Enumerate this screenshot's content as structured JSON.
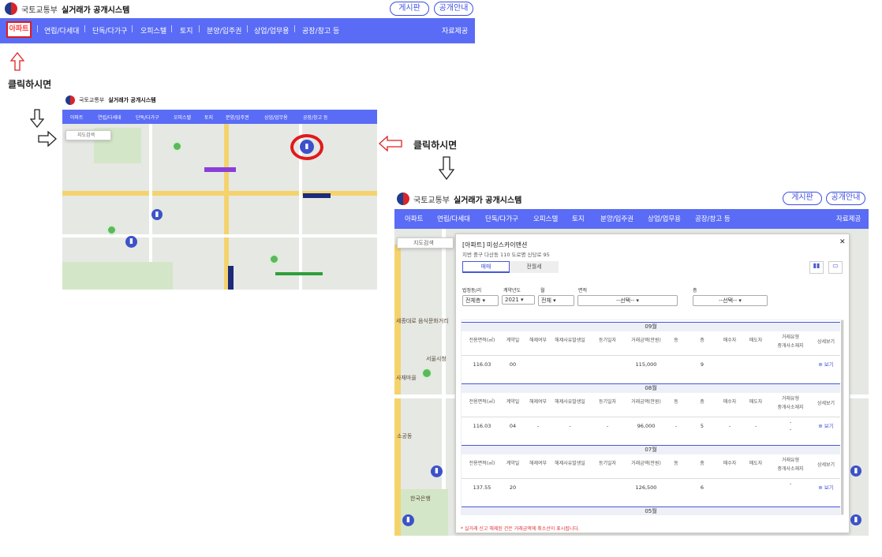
{
  "brand": {
    "org": "국토교통부",
    "system": "실거래가 공개시스템"
  },
  "top_buttons": {
    "board": "게시판",
    "info": "공개안내"
  },
  "nav": {
    "items": [
      "아파트",
      "연립/다세대",
      "단독/다가구",
      "오피스텔",
      "토지",
      "분양/입주권",
      "상업/업무용",
      "공장/창고 등"
    ],
    "right": "자료제공"
  },
  "annotations": {
    "click1": "클릭하시면",
    "click2": "클릭하시면"
  },
  "map_small": {
    "search_placeholder": "지도검색"
  },
  "map_large": {
    "search_placeholder": "지도검색",
    "labels": [
      "세종대로 음식문화거리",
      "서울시청",
      "사재마을",
      "한국은행",
      "소공동"
    ]
  },
  "panel": {
    "title": "[아파트] 미성스카이맨션",
    "address": "지번 중구 다산동 110   도로명 신당로 95",
    "tabs": [
      "매매",
      "전월세"
    ],
    "filters": {
      "labels": [
        "법정동/리",
        "계약년도",
        "월",
        "면적",
        "층"
      ],
      "values": [
        "전체층",
        "2021",
        "전체",
        "--선택--",
        "--선택--"
      ]
    },
    "columns": [
      "전용면적(㎡)",
      "계약일",
      "해제여부",
      "해제사유발생일",
      "등기일자",
      "거래금액(만원)",
      "동",
      "층",
      "매수자",
      "매도자",
      "거래유형",
      "중개사소재지",
      "상세보기"
    ],
    "groups": [
      {
        "month": "09월",
        "row": {
          "area": "116.03",
          "day": "00",
          "cancel": "",
          "reason": "",
          "reg": "",
          "amount": "115,000",
          "dong": "",
          "floor": "9",
          "buyer": "",
          "seller": "",
          "type": "",
          "agent": "",
          "view": "보기"
        }
      },
      {
        "month": "08월",
        "row": {
          "area": "116.03",
          "day": "04",
          "cancel": "-",
          "reason": "-",
          "reg": "-",
          "amount": "96,000",
          "dong": "-",
          "floor": "5",
          "buyer": "-",
          "seller": "-",
          "type": "-",
          "agent": "-",
          "view": "보기"
        }
      },
      {
        "month": "07월",
        "row": {
          "area": "137.55",
          "day": "20",
          "cancel": "",
          "reason": "",
          "reg": "",
          "amount": "126,500",
          "dong": "",
          "floor": "6",
          "buyer": "",
          "seller": "",
          "type": "",
          "agent": "-",
          "view": "보기"
        }
      },
      {
        "month": "05월"
      }
    ],
    "footnote": "* 실거래 신고 해제된 건은 거래금액에 취소선이 표시됩니다."
  }
}
